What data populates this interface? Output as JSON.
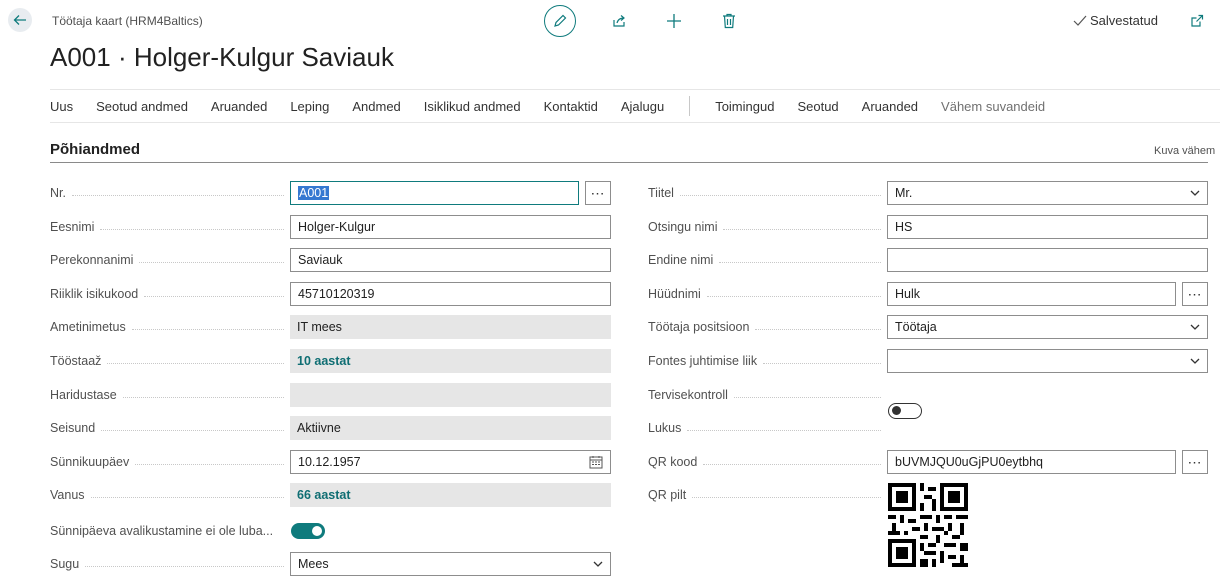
{
  "header": {
    "breadcrumb": "Töötaja kaart (HRM4Baltics)",
    "title": "A001 · Holger-Kulgur Saviauk",
    "status": "Salvestatud"
  },
  "nav": {
    "items": [
      "Uus",
      "Seotud andmed",
      "Aruanded",
      "Leping",
      "Andmed",
      "Isiklikud andmed",
      "Kontaktid",
      "Ajalugu"
    ],
    "items2": [
      "Toimingud",
      "Seotud",
      "Aruanded"
    ],
    "less_options": "Vähem suvandeid"
  },
  "section": {
    "title": "Põhiandmed",
    "show_less": "Kuva vähem"
  },
  "left": {
    "nr": {
      "label": "Nr.",
      "value": "A001"
    },
    "first_name": {
      "label": "Eesnimi",
      "value": "Holger-Kulgur"
    },
    "last_name": {
      "label": "Perekonnanimi",
      "value": "Saviauk"
    },
    "personal_code": {
      "label": "Riiklik isikukood",
      "value": "45710120319"
    },
    "job_title": {
      "label": "Ametinimetus",
      "value": "IT mees"
    },
    "seniority": {
      "label": "Tööstaaž",
      "value": "10 aastat"
    },
    "education": {
      "label": "Haridustase",
      "value": ""
    },
    "status": {
      "label": "Seisund",
      "value": "Aktiivne"
    },
    "birth_date": {
      "label": "Sünnikuupäev",
      "value": "10.12.1957"
    },
    "age": {
      "label": "Vanus",
      "value": "66 aastat"
    },
    "birthday_public": {
      "label": "Sünnipäeva avalikustamine ei ole luba...",
      "on": true
    },
    "gender": {
      "label": "Sugu",
      "value": "Mees"
    }
  },
  "right": {
    "title": {
      "label": "Tiitel",
      "value": "Mr."
    },
    "search_name": {
      "label": "Otsingu nimi",
      "value": "HS"
    },
    "former_name": {
      "label": "Endine nimi",
      "value": ""
    },
    "nickname": {
      "label": "Hüüdnimi",
      "value": "Hulk"
    },
    "position": {
      "label": "Töötaja positsioon",
      "value": "Töötaja"
    },
    "mgmt_type": {
      "label": "Fontes juhtimise liik",
      "value": ""
    },
    "health_check": {
      "label": "Tervisekontroll",
      "on": false
    },
    "locked": {
      "label": "Lukus",
      "on": false
    },
    "qr_code": {
      "label": "QR kood",
      "value": "bUVMJQU0uGjPU0eytbhq"
    },
    "qr_image": {
      "label": "QR pilt"
    }
  },
  "icons": {
    "assist": "⋯",
    "chevron": "chevron-down-icon"
  }
}
